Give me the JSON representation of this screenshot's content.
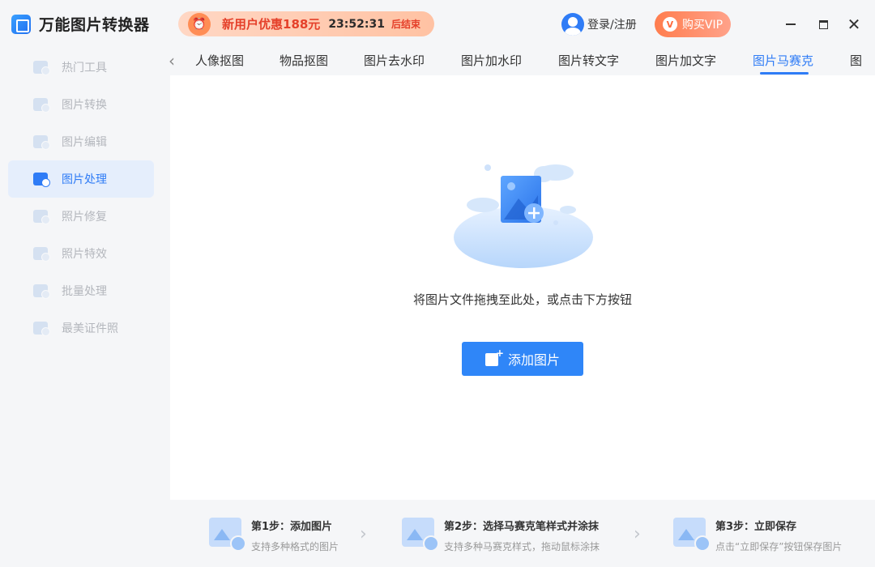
{
  "app": {
    "title": "万能图片转换器"
  },
  "sidebar": {
    "items": [
      {
        "label": "热门工具"
      },
      {
        "label": "图片转换"
      },
      {
        "label": "图片编辑"
      },
      {
        "label": "图片处理"
      },
      {
        "label": "照片修复"
      },
      {
        "label": "照片特效"
      },
      {
        "label": "批量处理"
      },
      {
        "label": "最美证件照"
      }
    ],
    "active_index": 3
  },
  "header": {
    "promo_text": "新用户优惠188元",
    "promo_time": "23:52:31",
    "promo_end": "后结束",
    "login_text": "登录/注册",
    "vip_text": "购买VIP"
  },
  "tabs": [
    {
      "label": "人像抠图"
    },
    {
      "label": "物品抠图"
    },
    {
      "label": "图片去水印"
    },
    {
      "label": "图片加水印"
    },
    {
      "label": "图片转文字"
    },
    {
      "label": "图片加文字"
    },
    {
      "label": "图片马赛克"
    },
    {
      "label": "图"
    }
  ],
  "main": {
    "drop_hint": "将图片文件拖拽至此处，或点击下方按钮",
    "add_button": "添加图片"
  },
  "steps": [
    {
      "title": "第1步：添加图片",
      "desc": "支持多种格式的图片"
    },
    {
      "title": "第2步：选择马赛克笔样式并涂抹",
      "desc": "支持多种马赛克样式，拖动鼠标涂抹"
    },
    {
      "title": "第3步：立即保存",
      "desc": "点击“立即保存”按钮保存图片"
    }
  ],
  "colors": {
    "accent": "#2f7cf6",
    "promo": "#e5402a",
    "vip": "#ff7d4e"
  }
}
